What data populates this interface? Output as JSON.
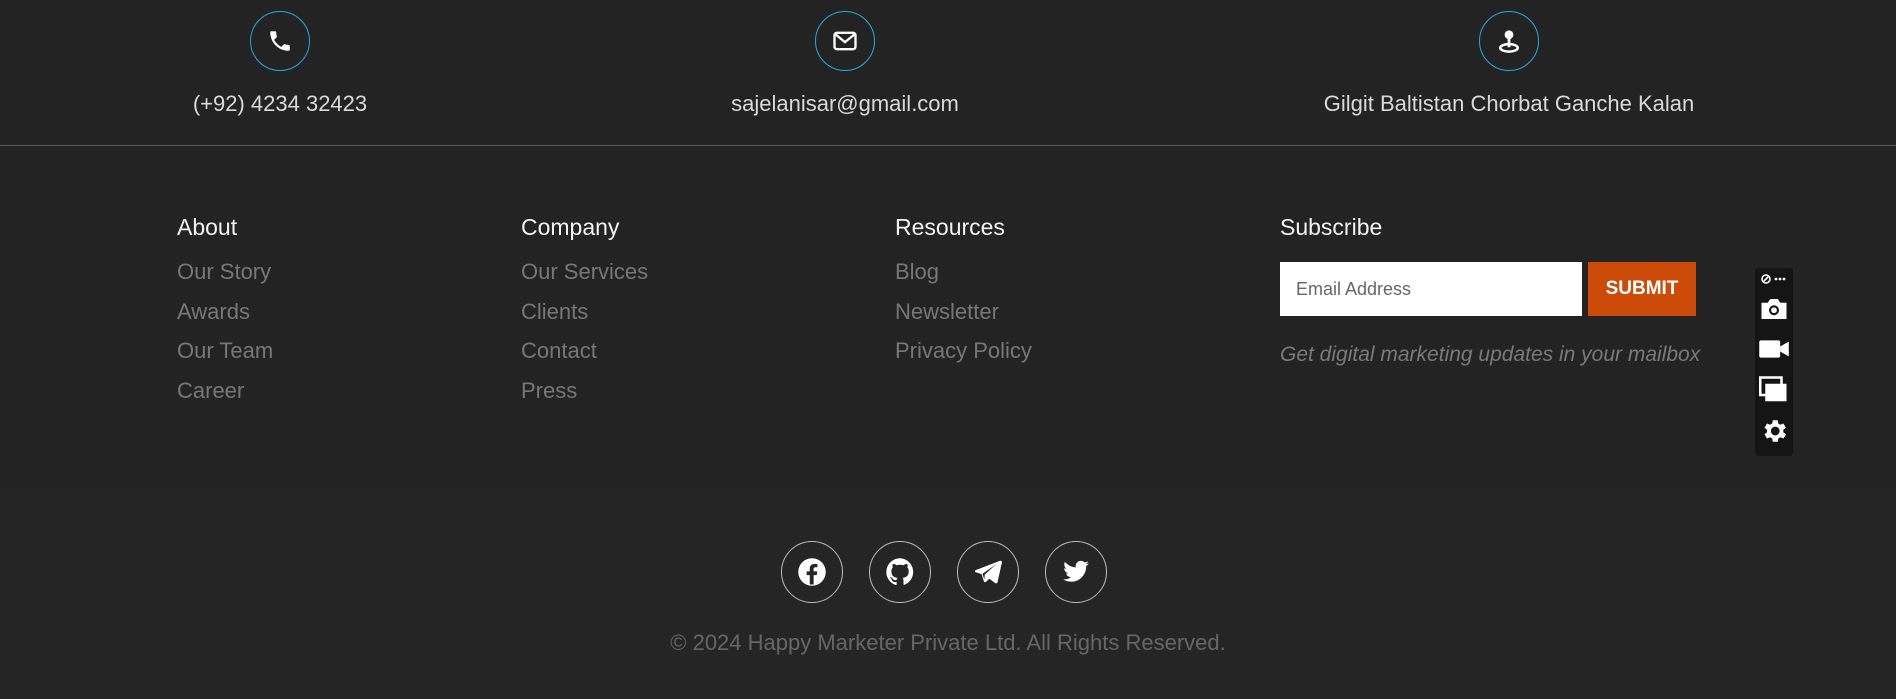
{
  "contacts": [
    {
      "icon": "phone-icon",
      "text": "(+92) 4234 32423"
    },
    {
      "icon": "mail-icon",
      "text": "sajelanisar@gmail.com"
    },
    {
      "icon": "location-pin-icon",
      "text": "Gilgit Baltistan Chorbat Ganche Kalan"
    }
  ],
  "about": {
    "heading": "About",
    "links": [
      "Our Story",
      "Awards",
      "Our Team",
      "Career"
    ]
  },
  "company": {
    "heading": "Company",
    "links": [
      "Our Services",
      "Clients",
      "Contact",
      "Press"
    ]
  },
  "resources": {
    "heading": "Resources",
    "links": [
      "Blog",
      "Newsletter",
      "Privacy Policy"
    ]
  },
  "subscribe": {
    "heading": "Subscribe",
    "email_placeholder": "Email Address",
    "email_value": "",
    "submit_label": "SUBMIT",
    "note": "Get digital marketing updates in your mailbox"
  },
  "toolbar": {
    "items": [
      "link-more-icon",
      "camera-icon",
      "video-icon",
      "windows-icon",
      "settings-icon"
    ]
  },
  "social": [
    "facebook-icon",
    "github-icon",
    "telegram-icon",
    "twitter-icon"
  ],
  "copyright": "© 2024 Happy Marketer Private Ltd. All Rights Reserved.",
  "colors": {
    "background": "#232323",
    "accent_ring": "#2aa7d6",
    "submit": "#cc4b08"
  }
}
